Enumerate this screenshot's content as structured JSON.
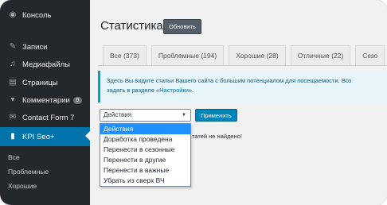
{
  "sidebar": {
    "items": [
      {
        "label": "Консоль",
        "icon": "dashboard-icon"
      },
      {
        "label": "Записи",
        "icon": "pin-icon"
      },
      {
        "label": "Медиафайлы",
        "icon": "media-icon"
      },
      {
        "label": "Страницы",
        "icon": "pages-icon"
      },
      {
        "label": "Комментарии",
        "icon": "comments-icon",
        "badge": "0"
      },
      {
        "label": "Contact Form 7",
        "icon": "mail-icon"
      },
      {
        "label": "KPI Seo+",
        "icon": "chart-icon"
      }
    ],
    "submenu": [
      "Все",
      "Проблемные",
      "Хорошие"
    ]
  },
  "page": {
    "title": "Статистика",
    "refresh_button": "Обновить"
  },
  "tabs": [
    "Все (373)",
    "Проблемные (194)",
    "Хорошие (28)",
    "Отличные (22)",
    "Сезо"
  ],
  "info": {
    "line1": "Здесь Вы видите статьи Вашего сайта с большим потенциалом для посещаемости. Воз",
    "line2_prefix": "задать в разделе «",
    "line2_link": "Настройки",
    "line2_suffix": "»."
  },
  "bulk": {
    "selected": "Действия",
    "apply": "Применить",
    "options": [
      "Действия",
      "Доработка проведена",
      "Перенести в сезонные",
      "Перенести в другие",
      "Перенести в важные",
      "Убрать из сверх ВЧ"
    ]
  },
  "empty_message": "татей не найдено!",
  "colors": {
    "sidebar_bg": "#23282d",
    "active_bg": "#0073aa",
    "primary_button": "#0085ba",
    "dropdown_selected": "#1e90ff",
    "info_bg": "#e5f5fa"
  }
}
